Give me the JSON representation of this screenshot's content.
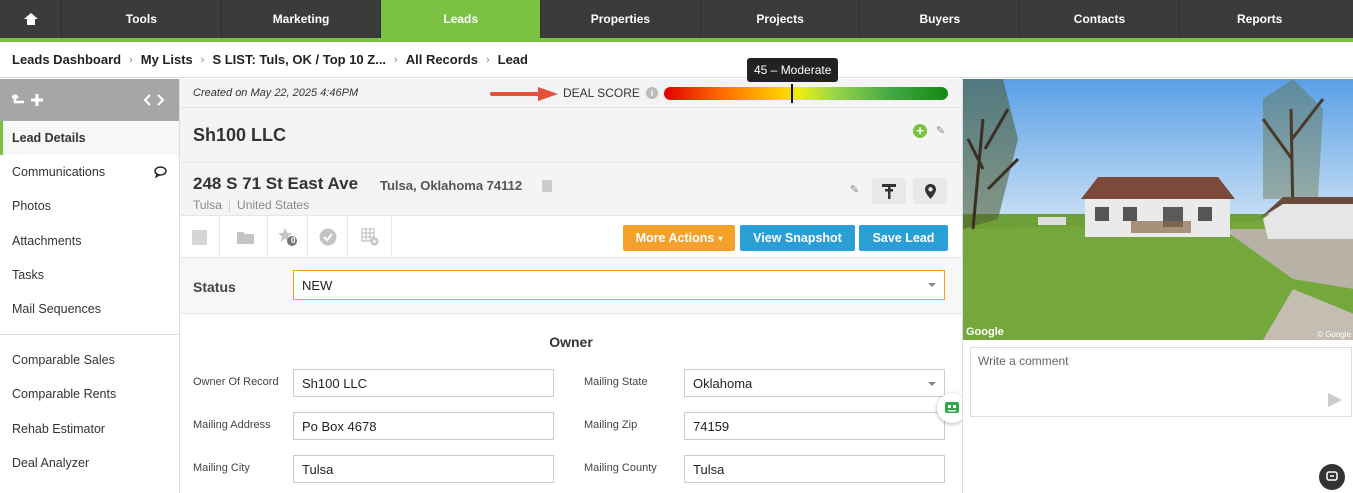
{
  "topnav": {
    "home_icon": "home-icon",
    "items": [
      "Tools",
      "Marketing",
      "Leads",
      "Properties",
      "Projects",
      "Buyers",
      "Contacts",
      "Reports"
    ],
    "active": "Leads",
    "accent": "#7cc242"
  },
  "breadcrumb": [
    "Leads Dashboard",
    "My Lists",
    "S LIST: Tuls, OK / Top 10 Z...",
    "All Records",
    "Lead"
  ],
  "sidebar": {
    "items": [
      "Lead Details",
      "Communications",
      "Photos",
      "Attachments",
      "Tasks",
      "Mail Sequences"
    ],
    "tools": [
      "Comparable Sales",
      "Comparable Rents",
      "Rehab Estimator",
      "Deal Analyzer"
    ]
  },
  "lead": {
    "created": "Created on May 22, 2025 4:46PM",
    "deal_score_label": "DEAL SCORE",
    "deal_score_tooltip": "45 – Moderate",
    "deal_score_value": 45,
    "name": "Sh100 LLC",
    "street": "248 S 71 St East Ave",
    "city_state_zip": "Tulsa, Oklahoma 74112",
    "city": "Tulsa",
    "country": "United States"
  },
  "actions": {
    "more_actions": "More Actions",
    "view_snapshot": "View Snapshot",
    "save_lead": "Save Lead",
    "star_badge": "0"
  },
  "status": {
    "label": "Status",
    "value": "NEW"
  },
  "owner": {
    "title": "Owner",
    "owner_of_record_label": "Owner Of Record",
    "owner_of_record": "Sh100 LLC",
    "mailing_address_label": "Mailing Address",
    "mailing_address": "Po Box 4678",
    "mailing_city_label": "Mailing City",
    "mailing_city": "Tulsa",
    "mailing_state_label": "Mailing State",
    "mailing_state": "Oklahoma",
    "mailing_zip_label": "Mailing Zip",
    "mailing_zip": "74159",
    "mailing_county_label": "Mailing County",
    "mailing_county": "Tulsa"
  },
  "right": {
    "google": "Google",
    "copyright": "© Google",
    "comment_placeholder": "Write a comment"
  }
}
